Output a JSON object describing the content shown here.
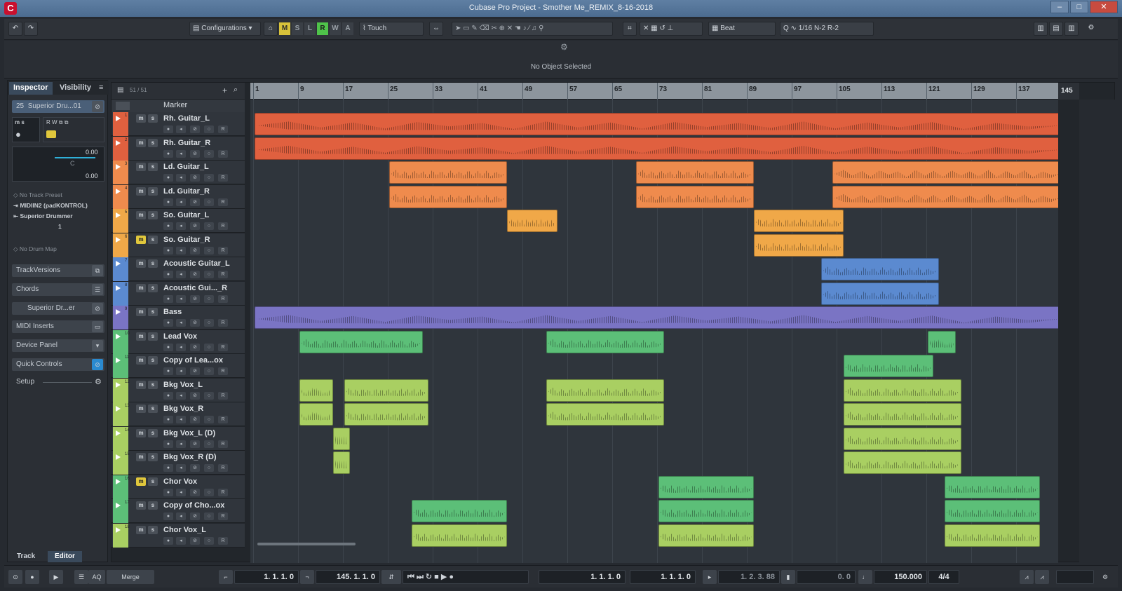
{
  "window": {
    "title": "Cubase Pro Project - Smother Me_REMIX_8-16-2018",
    "logo": "cubase-logo-icon"
  },
  "toolbar": {
    "configurations": "Configurations",
    "automation_modes": [
      "M",
      "S",
      "L",
      "R",
      "W",
      "A"
    ],
    "automation_mode": "Touch",
    "snap_type": "Beat",
    "quantize": "1/16 N-2 R-2"
  },
  "info_line": {
    "status": "No Object Selected"
  },
  "inspector": {
    "tabs": [
      "Inspector",
      "Visibility"
    ],
    "track_name": "Superior Dru...01",
    "track_num": "25",
    "volume": "0.00",
    "pan_label": "C",
    "pan_value": "0.00",
    "preset": "No Track Preset",
    "midi_in": "MIDIIN2 (padKONTROL)",
    "instrument": "Superior Drummer",
    "channel": "1",
    "drum_map": "No Drum Map",
    "sections": [
      "TrackVersions",
      "Chords",
      "Superior Dr...er",
      "MIDI Inserts",
      "Device Panel",
      "Quick Controls"
    ],
    "setup": "Setup",
    "bottom_tabs": [
      "Track",
      "Editor"
    ]
  },
  "tracklist": {
    "count_label": "51 / 51",
    "marker_label": "Marker",
    "tracks": [
      {
        "n": "1",
        "name": "Rh. Guitar_L",
        "color": "#e0603f",
        "lane": "#2f353c"
      },
      {
        "n": "2",
        "name": "Rh. Guitar_R",
        "color": "#e0603f",
        "lane": "#2f353c"
      },
      {
        "n": "3",
        "name": "Ld. Guitar_L",
        "color": "#ef8b4d",
        "lane": "#2f353c"
      },
      {
        "n": "4",
        "name": "Ld. Guitar_R",
        "color": "#ef8b4d",
        "lane": "#2f353c"
      },
      {
        "n": "5",
        "name": "So. Guitar_L",
        "color": "#f0a848",
        "lane": "#2f353c"
      },
      {
        "n": "6",
        "name": "So. Guitar_R",
        "color": "#f0a848",
        "lane": "#2f353c"
      },
      {
        "n": "7",
        "name": "Acoustic Guitar_L",
        "color": "#5b8ad0",
        "lane": "#2f353c"
      },
      {
        "n": "8",
        "name": "Acoustic Gui..._R",
        "color": "#5b8ad0",
        "lane": "#2f353c"
      },
      {
        "n": "9",
        "name": "Bass",
        "color": "#7a74c4",
        "lane": "#2f353c"
      },
      {
        "n": "10",
        "name": "Lead Vox",
        "color": "#5cbf78",
        "lane": "#2f353c"
      },
      {
        "n": "11",
        "name": "Copy of Lea...ox",
        "color": "#5cbf78",
        "lane": "#2f353c"
      },
      {
        "n": "12",
        "name": "Bkg Vox_L",
        "color": "#a9cf62",
        "lane": "#2f353c"
      },
      {
        "n": "13",
        "name": "Bkg Vox_R",
        "color": "#a9cf62",
        "lane": "#2f353c"
      },
      {
        "n": "14",
        "name": "Bkg Vox_L (D)",
        "color": "#a9cf62",
        "lane": "#2f353c"
      },
      {
        "n": "15",
        "name": "Bkg Vox_R (D)",
        "color": "#a9cf62",
        "lane": "#2f353c"
      },
      {
        "n": "16",
        "name": "Chor Vox",
        "color": "#5cbf78",
        "lane": "#2f353c"
      },
      {
        "n": "17",
        "name": "Copy of Cho...ox",
        "color": "#5cbf78",
        "lane": "#2f353c"
      },
      {
        "n": "18",
        "name": "Chor Vox_L",
        "color": "#a9cf62",
        "lane": "#2f353c"
      }
    ]
  },
  "ruler": {
    "bars": [
      "1",
      "9",
      "17",
      "25",
      "33",
      "41",
      "49",
      "57",
      "65",
      "73",
      "81",
      "89",
      "97",
      "105",
      "113",
      "121",
      "129",
      "137"
    ],
    "end_bar": "145"
  },
  "transport": {
    "left_locator": "1. 1. 1.   0",
    "right_locator": "145. 1. 1.   0",
    "primary_time": "1. 1. 1.   0",
    "secondary_time": "1. 1. 1.   0",
    "punch_time": "1. 2. 3. 88",
    "offset": "0.   0",
    "tempo": "150.000",
    "signature": "4/4",
    "merge": "Merge",
    "aq": "AQ"
  }
}
